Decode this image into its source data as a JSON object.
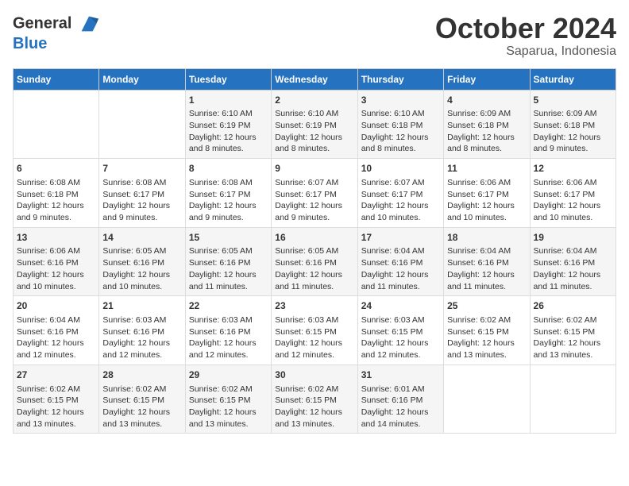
{
  "header": {
    "logo_line1": "General",
    "logo_line2": "Blue",
    "month": "October 2024",
    "location": "Saparua, Indonesia"
  },
  "weekdays": [
    "Sunday",
    "Monday",
    "Tuesday",
    "Wednesday",
    "Thursday",
    "Friday",
    "Saturday"
  ],
  "weeks": [
    [
      {
        "day": "",
        "sunrise": "",
        "sunset": "",
        "daylight": ""
      },
      {
        "day": "",
        "sunrise": "",
        "sunset": "",
        "daylight": ""
      },
      {
        "day": "1",
        "sunrise": "Sunrise: 6:10 AM",
        "sunset": "Sunset: 6:19 PM",
        "daylight": "Daylight: 12 hours and 8 minutes."
      },
      {
        "day": "2",
        "sunrise": "Sunrise: 6:10 AM",
        "sunset": "Sunset: 6:19 PM",
        "daylight": "Daylight: 12 hours and 8 minutes."
      },
      {
        "day": "3",
        "sunrise": "Sunrise: 6:10 AM",
        "sunset": "Sunset: 6:18 PM",
        "daylight": "Daylight: 12 hours and 8 minutes."
      },
      {
        "day": "4",
        "sunrise": "Sunrise: 6:09 AM",
        "sunset": "Sunset: 6:18 PM",
        "daylight": "Daylight: 12 hours and 8 minutes."
      },
      {
        "day": "5",
        "sunrise": "Sunrise: 6:09 AM",
        "sunset": "Sunset: 6:18 PM",
        "daylight": "Daylight: 12 hours and 9 minutes."
      }
    ],
    [
      {
        "day": "6",
        "sunrise": "Sunrise: 6:08 AM",
        "sunset": "Sunset: 6:18 PM",
        "daylight": "Daylight: 12 hours and 9 minutes."
      },
      {
        "day": "7",
        "sunrise": "Sunrise: 6:08 AM",
        "sunset": "Sunset: 6:17 PM",
        "daylight": "Daylight: 12 hours and 9 minutes."
      },
      {
        "day": "8",
        "sunrise": "Sunrise: 6:08 AM",
        "sunset": "Sunset: 6:17 PM",
        "daylight": "Daylight: 12 hours and 9 minutes."
      },
      {
        "day": "9",
        "sunrise": "Sunrise: 6:07 AM",
        "sunset": "Sunset: 6:17 PM",
        "daylight": "Daylight: 12 hours and 9 minutes."
      },
      {
        "day": "10",
        "sunrise": "Sunrise: 6:07 AM",
        "sunset": "Sunset: 6:17 PM",
        "daylight": "Daylight: 12 hours and 10 minutes."
      },
      {
        "day": "11",
        "sunrise": "Sunrise: 6:06 AM",
        "sunset": "Sunset: 6:17 PM",
        "daylight": "Daylight: 12 hours and 10 minutes."
      },
      {
        "day": "12",
        "sunrise": "Sunrise: 6:06 AM",
        "sunset": "Sunset: 6:17 PM",
        "daylight": "Daylight: 12 hours and 10 minutes."
      }
    ],
    [
      {
        "day": "13",
        "sunrise": "Sunrise: 6:06 AM",
        "sunset": "Sunset: 6:16 PM",
        "daylight": "Daylight: 12 hours and 10 minutes."
      },
      {
        "day": "14",
        "sunrise": "Sunrise: 6:05 AM",
        "sunset": "Sunset: 6:16 PM",
        "daylight": "Daylight: 12 hours and 10 minutes."
      },
      {
        "day": "15",
        "sunrise": "Sunrise: 6:05 AM",
        "sunset": "Sunset: 6:16 PM",
        "daylight": "Daylight: 12 hours and 11 minutes."
      },
      {
        "day": "16",
        "sunrise": "Sunrise: 6:05 AM",
        "sunset": "Sunset: 6:16 PM",
        "daylight": "Daylight: 12 hours and 11 minutes."
      },
      {
        "day": "17",
        "sunrise": "Sunrise: 6:04 AM",
        "sunset": "Sunset: 6:16 PM",
        "daylight": "Daylight: 12 hours and 11 minutes."
      },
      {
        "day": "18",
        "sunrise": "Sunrise: 6:04 AM",
        "sunset": "Sunset: 6:16 PM",
        "daylight": "Daylight: 12 hours and 11 minutes."
      },
      {
        "day": "19",
        "sunrise": "Sunrise: 6:04 AM",
        "sunset": "Sunset: 6:16 PM",
        "daylight": "Daylight: 12 hours and 11 minutes."
      }
    ],
    [
      {
        "day": "20",
        "sunrise": "Sunrise: 6:04 AM",
        "sunset": "Sunset: 6:16 PM",
        "daylight": "Daylight: 12 hours and 12 minutes."
      },
      {
        "day": "21",
        "sunrise": "Sunrise: 6:03 AM",
        "sunset": "Sunset: 6:16 PM",
        "daylight": "Daylight: 12 hours and 12 minutes."
      },
      {
        "day": "22",
        "sunrise": "Sunrise: 6:03 AM",
        "sunset": "Sunset: 6:16 PM",
        "daylight": "Daylight: 12 hours and 12 minutes."
      },
      {
        "day": "23",
        "sunrise": "Sunrise: 6:03 AM",
        "sunset": "Sunset: 6:15 PM",
        "daylight": "Daylight: 12 hours and 12 minutes."
      },
      {
        "day": "24",
        "sunrise": "Sunrise: 6:03 AM",
        "sunset": "Sunset: 6:15 PM",
        "daylight": "Daylight: 12 hours and 12 minutes."
      },
      {
        "day": "25",
        "sunrise": "Sunrise: 6:02 AM",
        "sunset": "Sunset: 6:15 PM",
        "daylight": "Daylight: 12 hours and 13 minutes."
      },
      {
        "day": "26",
        "sunrise": "Sunrise: 6:02 AM",
        "sunset": "Sunset: 6:15 PM",
        "daylight": "Daylight: 12 hours and 13 minutes."
      }
    ],
    [
      {
        "day": "27",
        "sunrise": "Sunrise: 6:02 AM",
        "sunset": "Sunset: 6:15 PM",
        "daylight": "Daylight: 12 hours and 13 minutes."
      },
      {
        "day": "28",
        "sunrise": "Sunrise: 6:02 AM",
        "sunset": "Sunset: 6:15 PM",
        "daylight": "Daylight: 12 hours and 13 minutes."
      },
      {
        "day": "29",
        "sunrise": "Sunrise: 6:02 AM",
        "sunset": "Sunset: 6:15 PM",
        "daylight": "Daylight: 12 hours and 13 minutes."
      },
      {
        "day": "30",
        "sunrise": "Sunrise: 6:02 AM",
        "sunset": "Sunset: 6:15 PM",
        "daylight": "Daylight: 12 hours and 13 minutes."
      },
      {
        "day": "31",
        "sunrise": "Sunrise: 6:01 AM",
        "sunset": "Sunset: 6:16 PM",
        "daylight": "Daylight: 12 hours and 14 minutes."
      },
      {
        "day": "",
        "sunrise": "",
        "sunset": "",
        "daylight": ""
      },
      {
        "day": "",
        "sunrise": "",
        "sunset": "",
        "daylight": ""
      }
    ]
  ]
}
